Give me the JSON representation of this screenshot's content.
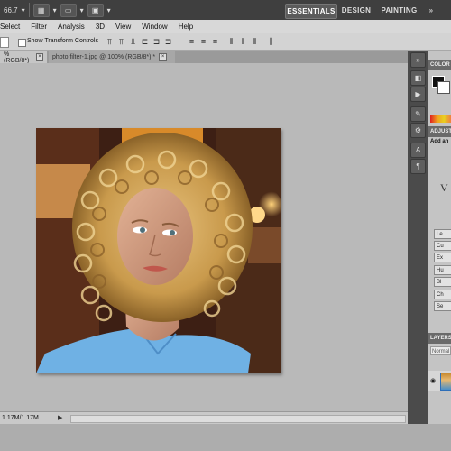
{
  "appbar": {
    "zoom": "66.7",
    "workspaces": [
      "ESSENTIALS",
      "DESIGN",
      "PAINTING",
      "»"
    ]
  },
  "menu": [
    "Select",
    "Filter",
    "Analysis",
    "3D",
    "View",
    "Window",
    "Help"
  ],
  "options": {
    "show_transform_label": "Show Transform Controls"
  },
  "tabs": [
    {
      "label": "% (RGB/8*)"
    },
    {
      "label": "photo filter-1.jpg @ 100% (RGB/8*) *"
    }
  ],
  "status": {
    "doc_size": "1.17M/1.17M"
  },
  "panels": {
    "color_title": "COLOR",
    "adjustments_title": "ADJUST",
    "adjustments_subtitle": "Add an",
    "adjustments_items": [
      "Le",
      "Cu",
      "Ex",
      "Hu",
      "Bl",
      "Ch",
      "Se"
    ],
    "layers_title": "LAYERS",
    "blend_mode": "Normal"
  }
}
